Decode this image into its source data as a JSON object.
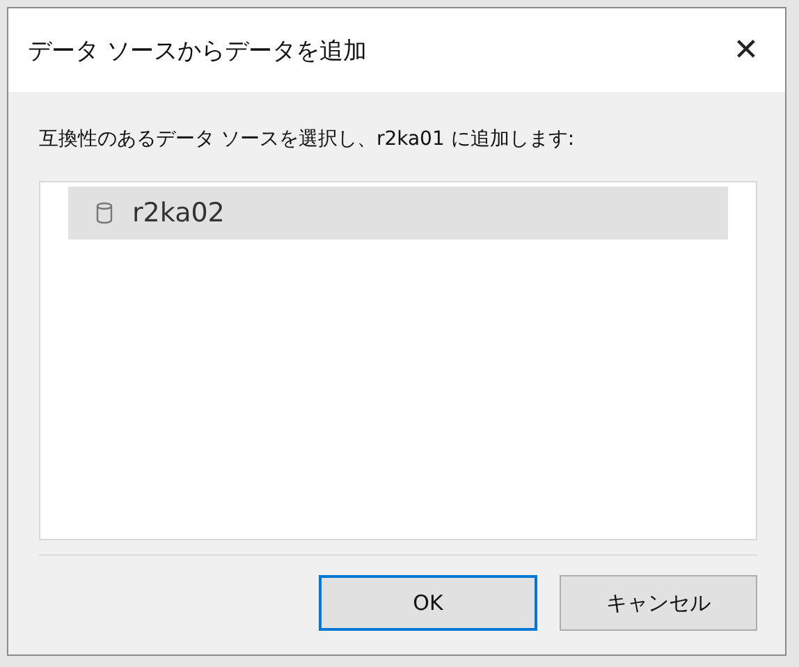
{
  "window": {
    "title": "データ ソースからデータを追加",
    "close": "✕"
  },
  "instruction": "互換性のあるデータ ソースを選択し、r2ka01 に追加します:",
  "sources": [
    {
      "name": "r2ka02",
      "selected": true
    }
  ],
  "buttons": [
    {
      "label": "OK",
      "default": true
    },
    {
      "label": "キャンセル",
      "default": false
    }
  ]
}
